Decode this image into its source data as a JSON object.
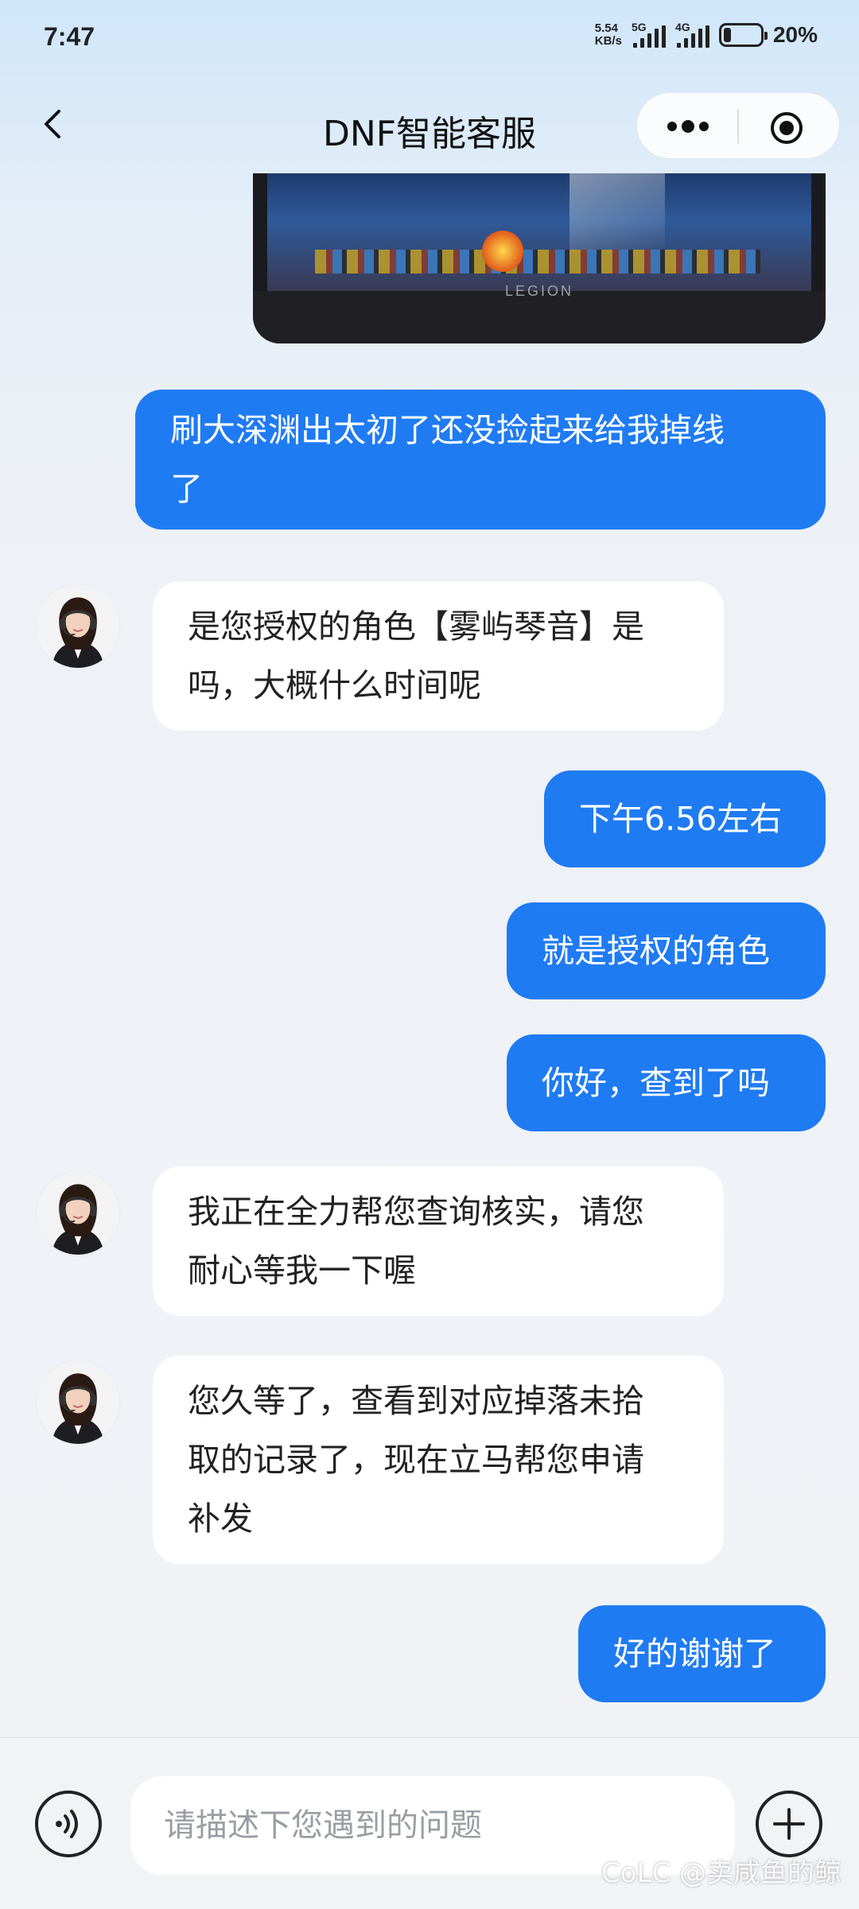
{
  "status_bar": {
    "time": "7:47",
    "net_speed_value": "5.54",
    "net_speed_unit": "KB/s",
    "signal_1_label": "5G",
    "signal_2_label": "4G",
    "battery_percent": "20%",
    "battery_level": 0.2
  },
  "nav": {
    "title": "DNF智能客服",
    "back_icon": "chevron-left-icon",
    "more_icon": "more-dots-icon",
    "target_icon": "target-circle-icon"
  },
  "image_message": {
    "brand_text": "LEGION"
  },
  "messages": [
    {
      "sender": "user",
      "text_lines": [
        "刷大深渊出太初了还没捡起来给我掉线",
        "了"
      ]
    },
    {
      "sender": "agent",
      "text_lines": [
        "是您授权的角色【雾屿琴音】是",
        "吗，大概什么时间呢"
      ]
    },
    {
      "sender": "user",
      "text_lines": [
        "下午6.56左右"
      ]
    },
    {
      "sender": "user",
      "text_lines": [
        "就是授权的角色"
      ]
    },
    {
      "sender": "user",
      "text_lines": [
        "你好，查到了吗"
      ]
    },
    {
      "sender": "agent",
      "text_lines": [
        "我正在全力帮您查询核实，请您",
        "耐心等我一下喔"
      ]
    },
    {
      "sender": "agent",
      "text_lines": [
        "您久等了，查看到对应掉落未拾",
        "取的记录了，现在立马帮您申请",
        "补发"
      ]
    },
    {
      "sender": "user",
      "text_lines": [
        "好的谢谢了"
      ]
    }
  ],
  "input": {
    "placeholder": "请描述下您遇到的问题",
    "value": ""
  },
  "watermark": "@卖咸鱼的鲸",
  "watermark_logo": "CoLC",
  "colors": {
    "user_bubble": "#1f7bf2",
    "agent_bubble": "#ffffff",
    "background": "#eef1f6"
  }
}
